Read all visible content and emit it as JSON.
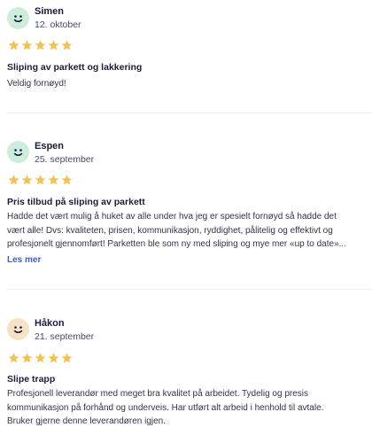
{
  "reviews": [
    {
      "name": "Simen",
      "date": "12. oktober",
      "avatar_color": "#cdeedd",
      "rating": 5,
      "title": "Sliping av parkett og lakkering",
      "text_lines": [
        "Veldig fornøyd!"
      ]
    },
    {
      "name": "Espen",
      "date": "25. september",
      "avatar_color": "#cdeedd",
      "rating": 5,
      "title": "Pris tilbud på sliping av parkett",
      "text_lines": [
        "Hadde det vært mulig å huket av alle under hva jeg er spesielt fornøyd så hadde det",
        "vært alle! Dvs: kvaliteten, prisen, kommunikasjon, ryddighet, pålitelig og effektivt og",
        "profesjonelt gjennomført! Parketten ble som ny med sliping og mye mer «up to date»..."
      ],
      "more_label": "Les mer"
    },
    {
      "name": "Håkon",
      "date": "21. september",
      "avatar_color": "#f7e3c4",
      "rating": 5,
      "title": "Slipe trapp",
      "text_lines": [
        "Profesjonell leverandør med meget bra kvalitet på arbeidet. Tydelig og presis",
        "kommunikasjon på forhånd og underveis. Har utført alt arbeid i henhold til avtale.",
        "Bruker gjerne denne leverandøren igjen."
      ]
    }
  ],
  "colors": {
    "star": "#f2c14e",
    "link": "#3b5bdb"
  }
}
